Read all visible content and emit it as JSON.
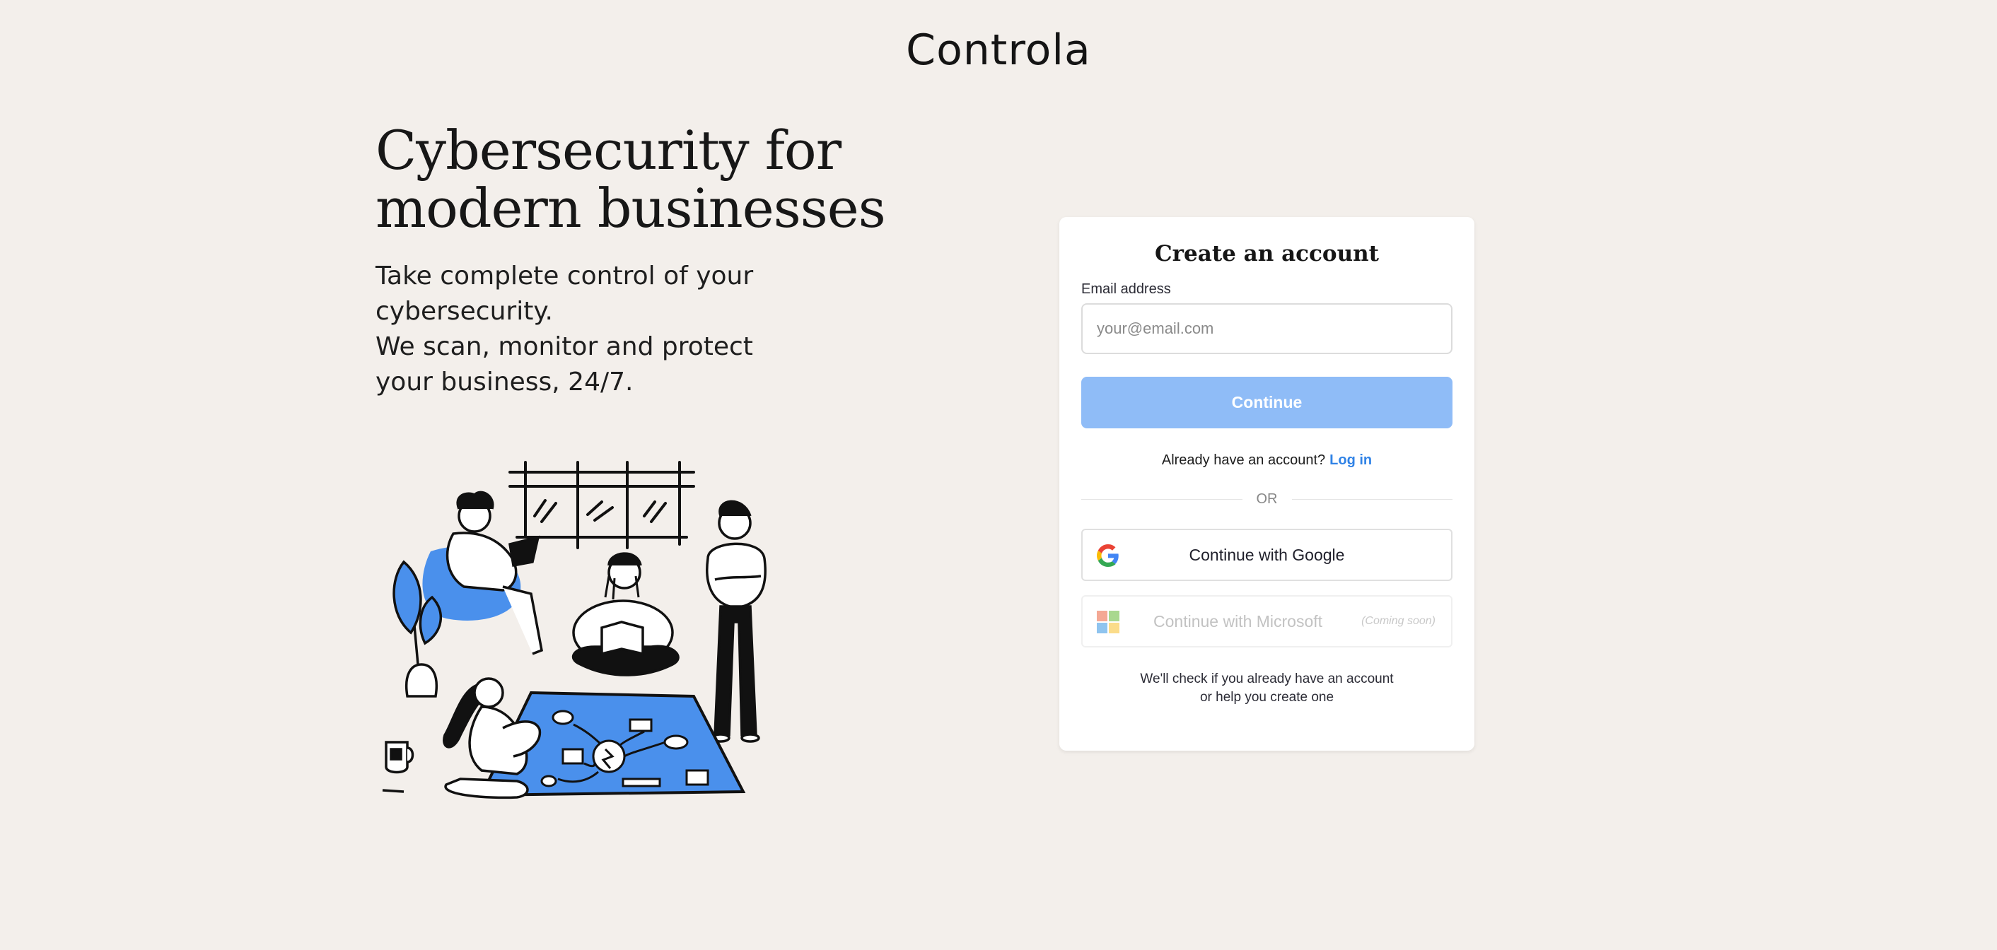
{
  "brand": {
    "name": "Controla"
  },
  "hero": {
    "headline_line1": "Cybersecurity for",
    "headline_line2": "modern businesses",
    "subline1": "Take complete control of your cybersecurity.",
    "subline2": "We scan, monitor and protect your business, 24/7."
  },
  "signup": {
    "title": "Create an account",
    "email_label": "Email address",
    "email_placeholder": "your@email.com",
    "email_value": "",
    "continue_label": "Continue",
    "login_prompt": "Already have an account?",
    "login_link": "Log in",
    "or_divider": "OR",
    "google_label": "Continue with Google",
    "microsoft_label": "Continue with Microsoft",
    "microsoft_badge": "(Coming soon)",
    "footnote_line1": "We'll check if you already have an account",
    "footnote_line2": "or help you create one"
  },
  "colors": {
    "background": "#f3efeb",
    "accent": "#3183e6",
    "button_disabled": "#8fbcf7",
    "illustration_blue": "#4a90ec"
  },
  "icons": {
    "google": "google-logo-icon",
    "microsoft": "microsoft-logo-icon"
  }
}
